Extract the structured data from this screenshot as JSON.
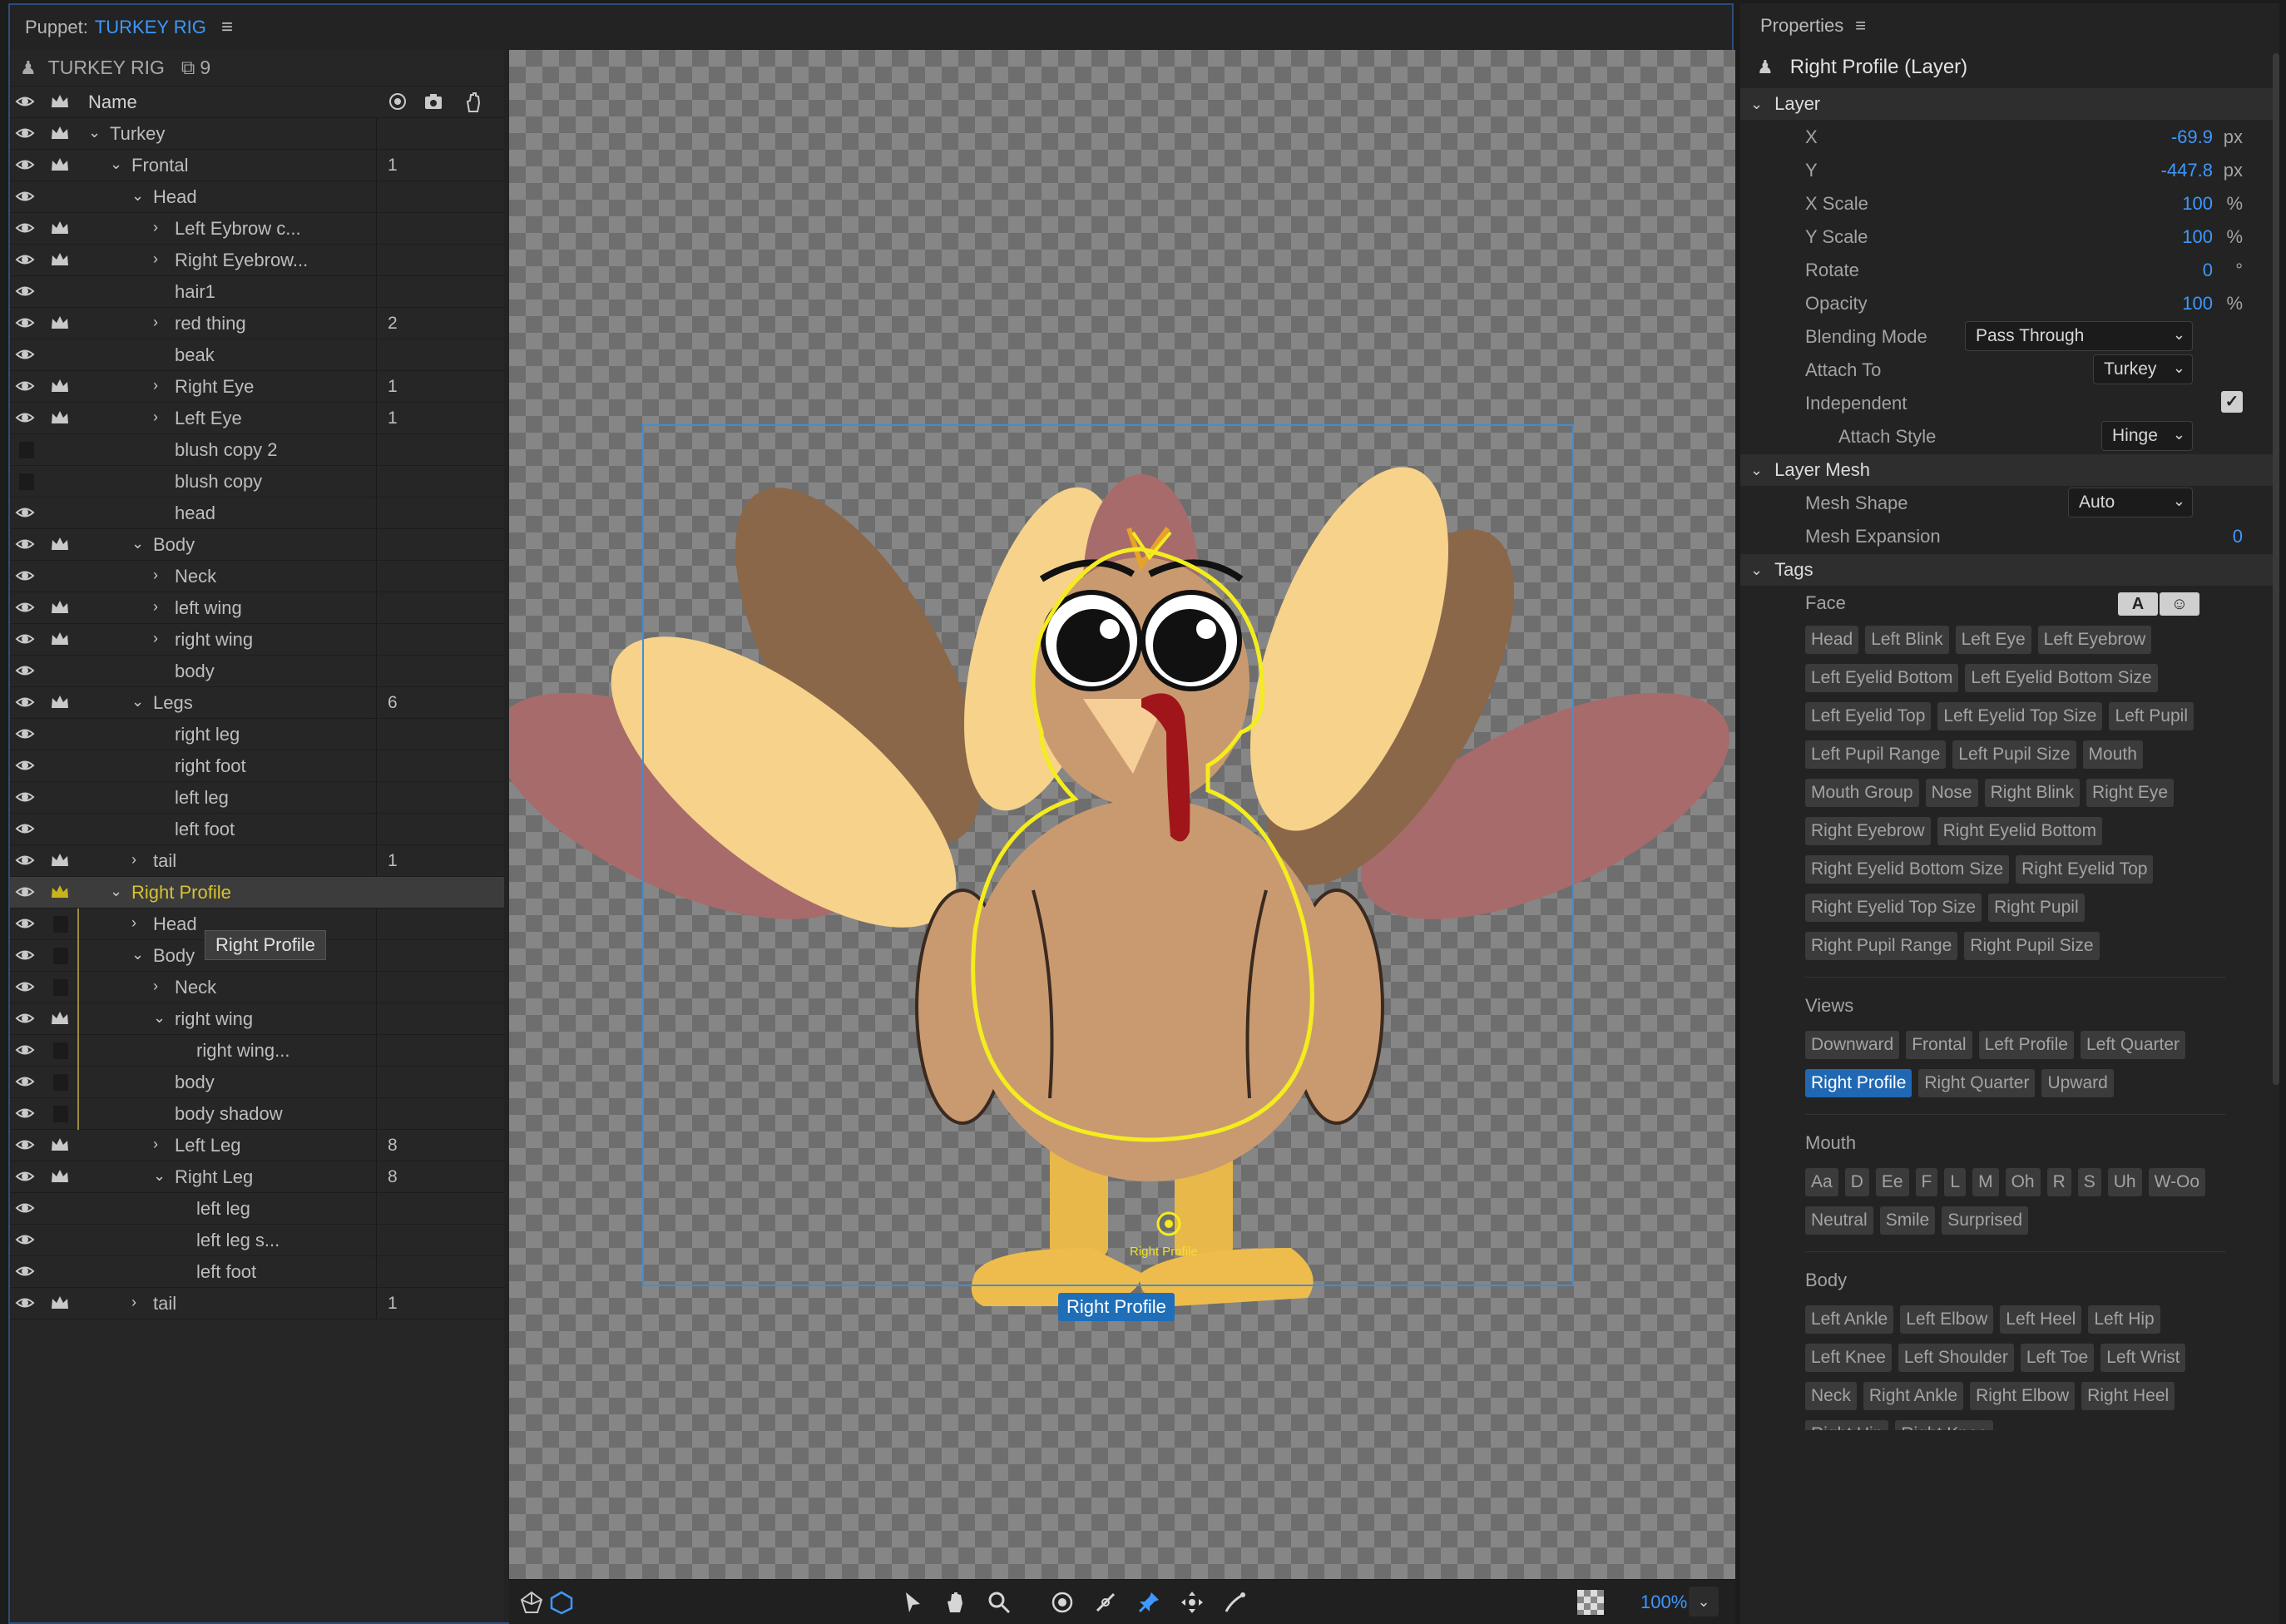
{
  "puppet_panel": {
    "prefix": "Puppet:",
    "name": "TURKEY RIG"
  },
  "tree": {
    "title": "TURKEY RIG",
    "count": "9",
    "col_name": "Name",
    "rows": [
      {
        "label": "Turkey",
        "depth": 0,
        "chev": "v",
        "crown": true,
        "num": ""
      },
      {
        "label": "Frontal",
        "depth": 1,
        "chev": "v",
        "crown": true,
        "num": "1"
      },
      {
        "label": "Head",
        "depth": 2,
        "chev": "v",
        "crown": false,
        "num": ""
      },
      {
        "label": "Left Eybrow c...",
        "depth": 3,
        "chev": ">",
        "crown": true,
        "num": ""
      },
      {
        "label": "Right Eyebrow...",
        "depth": 3,
        "chev": ">",
        "crown": true,
        "num": ""
      },
      {
        "label": "hair1",
        "depth": 3,
        "chev": "",
        "crown": false,
        "num": ""
      },
      {
        "label": "red thing",
        "depth": 3,
        "chev": ">",
        "crown": true,
        "num": "2"
      },
      {
        "label": "beak",
        "depth": 3,
        "chev": "",
        "crown": false,
        "num": ""
      },
      {
        "label": "Right Eye",
        "depth": 3,
        "chev": ">",
        "crown": true,
        "num": "1"
      },
      {
        "label": "Left Eye",
        "depth": 3,
        "chev": ">",
        "crown": true,
        "num": "1"
      },
      {
        "label": "blush copy 2",
        "depth": 3,
        "chev": "",
        "crown": false,
        "num": "",
        "hidden": true
      },
      {
        "label": "blush copy",
        "depth": 3,
        "chev": "",
        "crown": false,
        "num": "",
        "hidden": true
      },
      {
        "label": "head",
        "depth": 3,
        "chev": "",
        "crown": false,
        "num": ""
      },
      {
        "label": "Body",
        "depth": 2,
        "chev": "v",
        "crown": true,
        "num": ""
      },
      {
        "label": "Neck",
        "depth": 3,
        "chev": ">",
        "crown": false,
        "num": ""
      },
      {
        "label": "left wing",
        "depth": 3,
        "chev": ">",
        "crown": true,
        "num": ""
      },
      {
        "label": "right wing",
        "depth": 3,
        "chev": ">",
        "crown": true,
        "num": ""
      },
      {
        "label": "body",
        "depth": 3,
        "chev": "",
        "crown": false,
        "num": ""
      },
      {
        "label": "Legs",
        "depth": 2,
        "chev": "v",
        "crown": true,
        "num": "6"
      },
      {
        "label": "right leg",
        "depth": 3,
        "chev": "",
        "crown": false,
        "num": ""
      },
      {
        "label": "right foot",
        "depth": 3,
        "chev": "",
        "crown": false,
        "num": ""
      },
      {
        "label": "left leg",
        "depth": 3,
        "chev": "",
        "crown": false,
        "num": ""
      },
      {
        "label": "left foot",
        "depth": 3,
        "chev": "",
        "crown": false,
        "num": ""
      },
      {
        "label": "tail",
        "depth": 2,
        "chev": ">",
        "crown": true,
        "num": "1"
      },
      {
        "label": "Right Profile",
        "depth": 1,
        "chev": "v",
        "crown": true,
        "num": "",
        "selected": true
      },
      {
        "label": "Head",
        "depth": 2,
        "chev": ">",
        "crown": false,
        "num": "",
        "bar": true
      },
      {
        "label": "Body",
        "depth": 2,
        "chev": "v",
        "crown": false,
        "num": "",
        "bar": true
      },
      {
        "label": "Neck",
        "depth": 3,
        "chev": ">",
        "crown": false,
        "num": "",
        "bar": true
      },
      {
        "label": "right wing",
        "depth": 3,
        "chev": "v",
        "crown": true,
        "num": "",
        "bar": true
      },
      {
        "label": "right wing...",
        "depth": 4,
        "chev": "",
        "crown": false,
        "num": "",
        "bar": true
      },
      {
        "label": "body",
        "depth": 3,
        "chev": "",
        "crown": false,
        "num": "",
        "bar": true
      },
      {
        "label": "body shadow",
        "depth": 3,
        "chev": "",
        "crown": false,
        "num": "",
        "bar": true
      },
      {
        "label": "Left Leg",
        "depth": 3,
        "chev": ">",
        "crown": true,
        "num": "8"
      },
      {
        "label": "Right Leg",
        "depth": 3,
        "chev": "v",
        "crown": true,
        "num": "8"
      },
      {
        "label": "left leg",
        "depth": 4,
        "chev": "",
        "crown": false,
        "num": ""
      },
      {
        "label": "left leg s...",
        "depth": 4,
        "chev": "",
        "crown": false,
        "num": ""
      },
      {
        "label": "left foot",
        "depth": 4,
        "chev": "",
        "crown": false,
        "num": ""
      },
      {
        "label": "tail",
        "depth": 2,
        "chev": ">",
        "crown": true,
        "num": "1"
      }
    ],
    "tooltip": "Right Profile"
  },
  "canvas": {
    "selection_label": "Right Profile",
    "origin_label": "Right Profile",
    "zoom": "100%"
  },
  "props": {
    "title": "Properties",
    "layer_name": "Right Profile (Layer)",
    "sec_layer": "Layer",
    "x_label": "X",
    "x_val": "-69.9",
    "x_unit": "px",
    "y_label": "Y",
    "y_val": "-447.8",
    "y_unit": "px",
    "xs_label": "X Scale",
    "xs_val": "100",
    "xs_unit": "%",
    "ys_label": "Y Scale",
    "ys_val": "100",
    "ys_unit": "%",
    "rot_label": "Rotate",
    "rot_val": "0",
    "rot_unit": "°",
    "op_label": "Opacity",
    "op_val": "100",
    "op_unit": "%",
    "blend_label": "Blending Mode",
    "blend_val": "Pass Through",
    "attach_label": "Attach To",
    "attach_val": "Turkey",
    "indep_label": "Independent",
    "attstyle_label": "Attach Style",
    "attstyle_val": "Hinge",
    "sec_mesh": "Layer Mesh",
    "mesh_label": "Mesh Shape",
    "mesh_val": "Auto",
    "exp_label": "Mesh Expansion",
    "exp_val": "0",
    "sec_tags": "Tags",
    "face_label": "Face",
    "face_btn_a": "A",
    "face_tags": [
      "Head",
      "Left Blink",
      "Left Eye",
      "Left Eyebrow",
      "Left Eyelid Bottom",
      "Left Eyelid Bottom Size",
      "Left Eyelid Top",
      "Left Eyelid Top Size",
      "Left Pupil",
      "Left Pupil Range",
      "Left Pupil Size",
      "Mouth",
      "Mouth Group",
      "Nose",
      "Right Blink",
      "Right Eye",
      "Right Eyebrow",
      "Right Eyelid Bottom",
      "Right Eyelid Bottom Size",
      "Right Eyelid Top",
      "Right Eyelid Top Size",
      "Right Pupil",
      "Right Pupil Range",
      "Right Pupil Size"
    ],
    "views_label": "Views",
    "views_tags": [
      "Downward",
      "Frontal",
      "Left Profile",
      "Left Quarter",
      "Right Profile",
      "Right Quarter",
      "Upward"
    ],
    "views_active": "Right Profile",
    "mouth_label": "Mouth",
    "mouth_tags": [
      "Aa",
      "D",
      "Ee",
      "F",
      "L",
      "M",
      "Oh",
      "R",
      "S",
      "Uh",
      "W-Oo",
      "Neutral",
      "Smile",
      "Surprised"
    ],
    "body_label": "Body",
    "body_tags": [
      "Left Ankle",
      "Left Elbow",
      "Left Heel",
      "Left Hip",
      "Left Knee",
      "Left Shoulder",
      "Left Toe",
      "Left Wrist",
      "Neck",
      "Right Ankle",
      "Right Elbow",
      "Right Heel",
      "Right Hip",
      "Right Knee"
    ]
  },
  "colors": {
    "accent": "#3d98ff",
    "selection": "#c9b21c",
    "tag_active": "#2068b4"
  },
  "icons": [
    "eye-icon",
    "crown-icon",
    "puppet-icon",
    "camera-icon",
    "hand-icon",
    "search-icon",
    "pin-icon",
    "pen-icon",
    "dragger-icon",
    "stick-icon",
    "checkerboard-icon"
  ]
}
